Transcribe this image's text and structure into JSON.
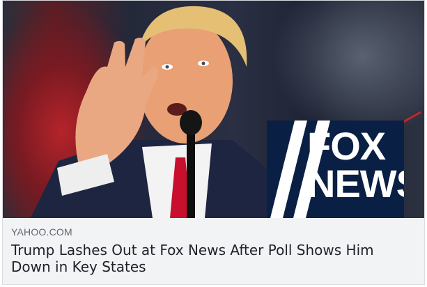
{
  "link_preview": {
    "domain": "YAHOO.COM",
    "headline": "Trump Lashes Out at Fox News After Poll Shows Him Down in Key States"
  },
  "image": {
    "logo_text": "FOX\nNEWS",
    "logo_background": "#0a1f44",
    "accent_red": "#c0282f"
  }
}
